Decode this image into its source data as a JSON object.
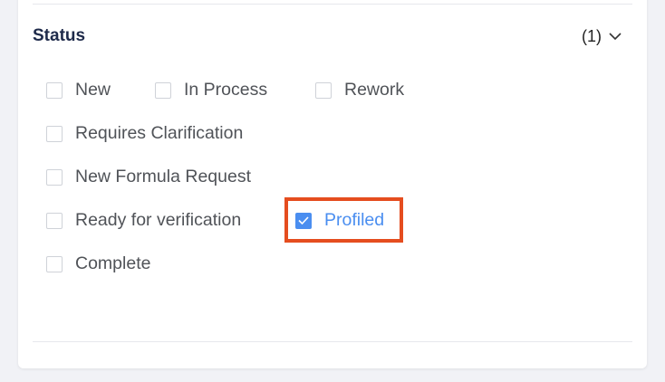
{
  "filter": {
    "title": "Status",
    "count": "(1)",
    "options": [
      {
        "label": "New",
        "checked": false
      },
      {
        "label": "In Process",
        "checked": false
      },
      {
        "label": "Rework",
        "checked": false
      },
      {
        "label": "Requires Clarification",
        "checked": false
      },
      {
        "label": "New Formula Request",
        "checked": false
      },
      {
        "label": "Ready for verification",
        "checked": false
      },
      {
        "label": "Profiled",
        "checked": true
      },
      {
        "label": "Complete",
        "checked": false
      }
    ]
  },
  "colors": {
    "accent": "#4a8ef0",
    "highlight": "#e54d1f",
    "title": "#1e2a4a"
  }
}
